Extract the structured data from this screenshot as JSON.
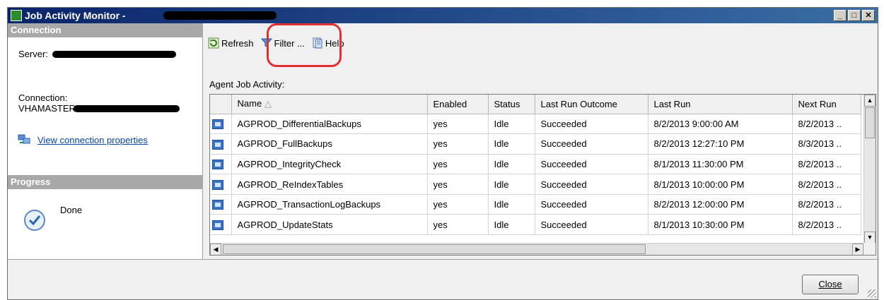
{
  "window": {
    "title": "Job Activity Monitor -",
    "controls": [
      "minimize",
      "maximize",
      "close"
    ]
  },
  "connection": {
    "header": "Connection",
    "server_label": "Server:",
    "connection_label": "Connection:",
    "connection_value": "VHAMASTER",
    "view_link": "View connection properties"
  },
  "progress": {
    "header": "Progress",
    "status": "Done"
  },
  "toolbar": {
    "refresh_label": "Refresh",
    "filter_label": "Filter ...",
    "help_label": "Help"
  },
  "grid": {
    "label": "Agent Job Activity:",
    "columns": [
      "Name",
      "Enabled",
      "Status",
      "Last Run Outcome",
      "Last Run",
      "Next Run"
    ],
    "sort_indicator": "△",
    "rows": [
      {
        "name": "AGPROD_DifferentialBackups",
        "enabled": "yes",
        "status": "Idle",
        "outcome": "Succeeded",
        "last_run": "8/2/2013 9:00:00 AM",
        "next_run": "8/2/2013 .."
      },
      {
        "name": "AGPROD_FullBackups",
        "enabled": "yes",
        "status": "Idle",
        "outcome": "Succeeded",
        "last_run": "8/2/2013 12:27:10 PM",
        "next_run": "8/3/2013 .."
      },
      {
        "name": "AGPROD_IntegrityCheck",
        "enabled": "yes",
        "status": "Idle",
        "outcome": "Succeeded",
        "last_run": "8/1/2013 11:30:00 PM",
        "next_run": "8/2/2013 .."
      },
      {
        "name": "AGPROD_ReIndexTables",
        "enabled": "yes",
        "status": "Idle",
        "outcome": "Succeeded",
        "last_run": "8/1/2013 10:00:00 PM",
        "next_run": "8/2/2013 .."
      },
      {
        "name": "AGPROD_TransactionLogBackups",
        "enabled": "yes",
        "status": "Idle",
        "outcome": "Succeeded",
        "last_run": "8/2/2013 12:00:00 PM",
        "next_run": "8/2/2013 .."
      },
      {
        "name": "AGPROD_UpdateStats",
        "enabled": "yes",
        "status": "Idle",
        "outcome": "Succeeded",
        "last_run": "8/1/2013 10:30:00 PM",
        "next_run": "8/2/2013 .."
      }
    ]
  },
  "footer": {
    "close_label": "Close"
  },
  "colors": {
    "titlebar": "#0a246a",
    "highlight": "#e23030",
    "link": "#0645ad"
  }
}
